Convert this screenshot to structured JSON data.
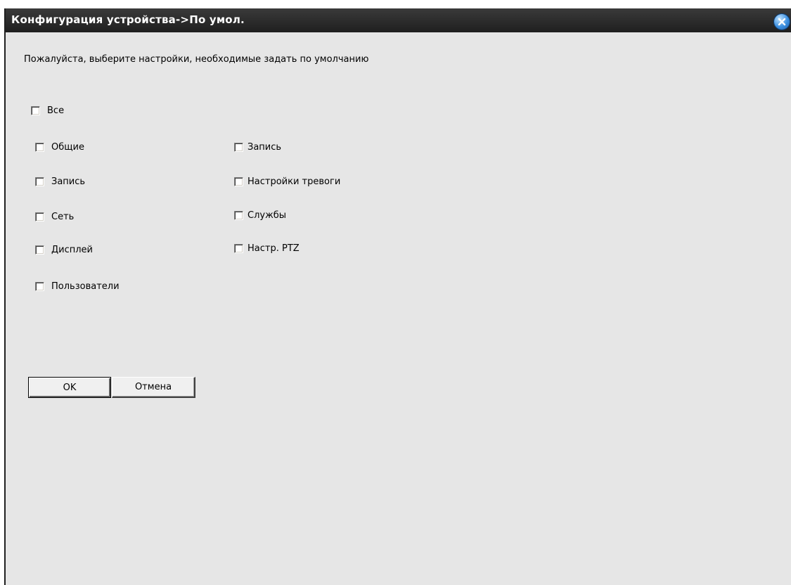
{
  "window": {
    "title": "Конфигурация устройства->По умол."
  },
  "prompt": "Пожалуйста, выберите настройки, необходимые задать по умолчанию",
  "checkboxes": {
    "all": {
      "label": "Все",
      "checked": false
    },
    "left": [
      {
        "label": "Общие",
        "checked": false
      },
      {
        "label": "Запись",
        "checked": false
      },
      {
        "label": "Сеть",
        "checked": false
      },
      {
        "label": "Дисплей",
        "checked": false
      },
      {
        "label": "Пользователи",
        "checked": false
      }
    ],
    "right": [
      {
        "label": "Запись",
        "checked": false
      },
      {
        "label": "Настройки тревоги",
        "checked": false
      },
      {
        "label": "Службы",
        "checked": false
      },
      {
        "label": "Настр. PTZ",
        "checked": false
      }
    ]
  },
  "buttons": {
    "ok_label": "OK",
    "cancel_label": "Отмена"
  },
  "icons": {
    "close": "close-icon"
  },
  "colors": {
    "titlebar": "#1f1f1f",
    "background": "#e6e6e6",
    "close_accent": "#3b8fe0"
  }
}
